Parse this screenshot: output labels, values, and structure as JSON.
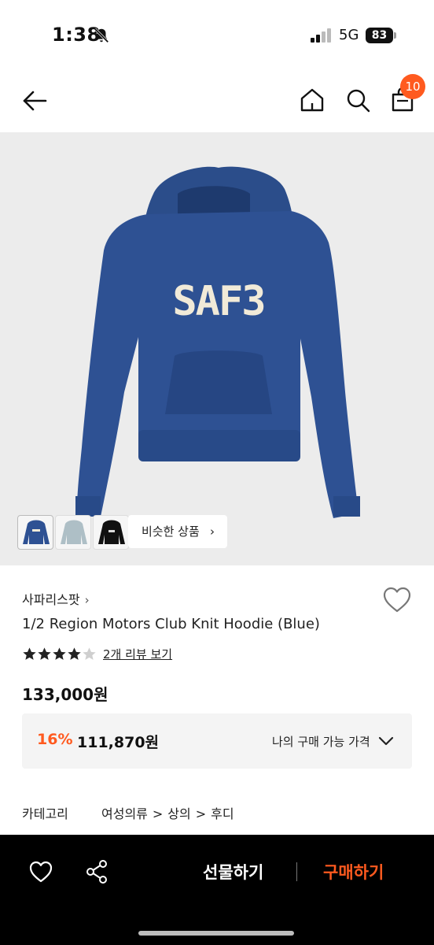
{
  "status_bar": {
    "time": "1:38",
    "network": "5G",
    "battery": "83"
  },
  "nav": {
    "cart_badge": "10",
    "accent_color": "#ff5a1f"
  },
  "product_image": {
    "similar_label": "비슷한 상품",
    "similar_chevron": "›"
  },
  "product": {
    "brand": "사파리스팟",
    "brand_chevron": "›",
    "name": "1/2 Region Motors Club Knit Hoodie (Blue)",
    "rating": 4,
    "rating_max": 5,
    "review_link": "2개 리뷰 보기",
    "price": "133,000원",
    "discount_rate": "16%",
    "discount_price": "111,870원",
    "discount_label": "나의 구매 가능 가격"
  },
  "category": {
    "label": "카테고리",
    "path": [
      "여성의류",
      "상의",
      "후디"
    ],
    "separator": ">"
  },
  "bottom_bar": {
    "gift_label": "선물하기",
    "buy_label": "구매하기"
  },
  "icons": {
    "back": "arrow-left-icon",
    "home": "home-icon",
    "search": "search-icon",
    "bag": "shopping-bag-icon",
    "wishlist": "heart-icon",
    "share": "share-icon"
  }
}
